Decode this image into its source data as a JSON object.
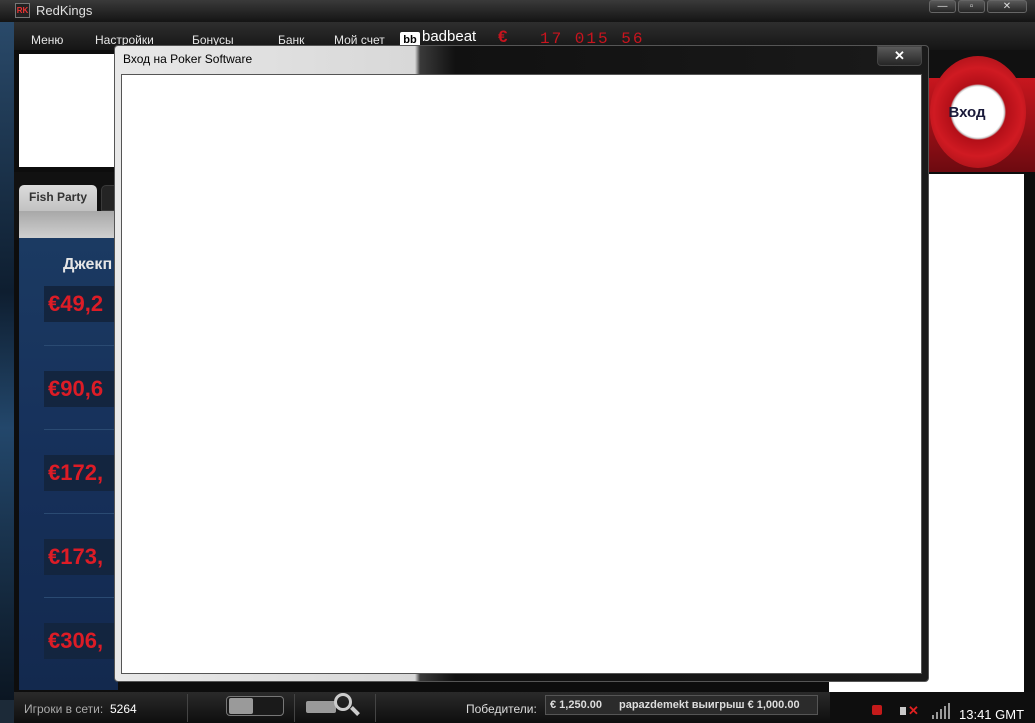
{
  "window": {
    "title": "RedKings",
    "logo_text": "RK",
    "btn_min": "—",
    "btn_max": "▫",
    "btn_close": "✕"
  },
  "menu": {
    "items": [
      "Меню",
      "Настройки",
      "Бонусы",
      "Банк",
      "Мой счет"
    ]
  },
  "badbeat": {
    "logo": "bb",
    "label": "badbeat",
    "euro": "€",
    "counter": "17 015 56"
  },
  "login_chip": {
    "label": "Вход"
  },
  "tabs": {
    "active": "Fish Party"
  },
  "jackpot": {
    "title": "Джекп",
    "values": [
      "€49,2",
      "€90,6",
      "€172,",
      "€173,",
      "€306,"
    ]
  },
  "dialog": {
    "title": "Вход на Poker Software",
    "close": "✕"
  },
  "status": {
    "players_label": "Игроки в сети:",
    "players_count": "5264",
    "winners_label": "Победители:",
    "winner_amount": "€ 1,250.00",
    "winner_text": "papazdemekt выигрыш € 1,000.00"
  },
  "tray": {
    "time": "13:41 GMT"
  },
  "colors": {
    "jackpot_red": "#dd1c26",
    "chip_red": "#c8141e",
    "dialog_bg": "#ffffff"
  }
}
